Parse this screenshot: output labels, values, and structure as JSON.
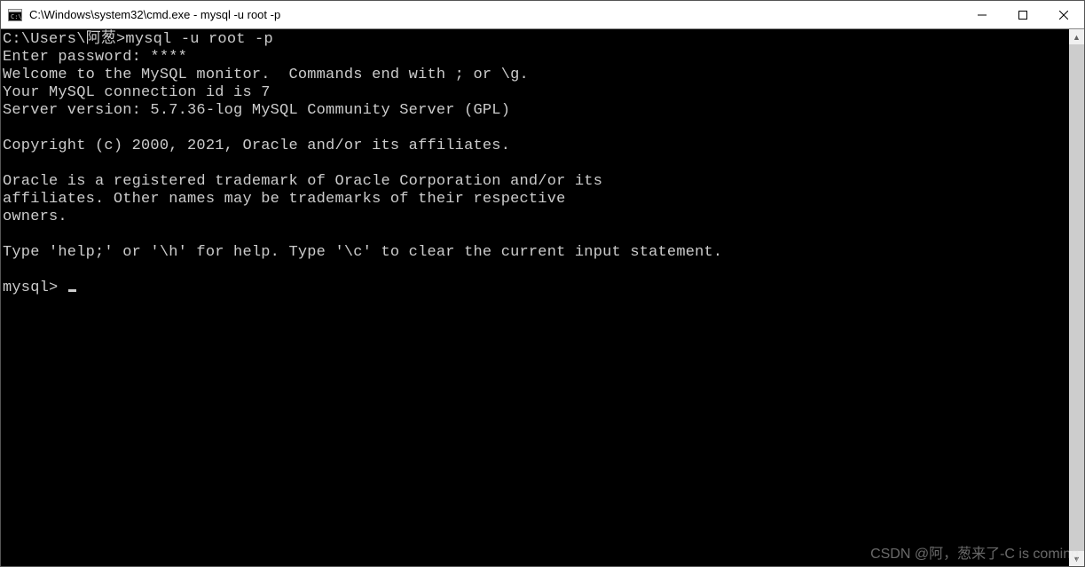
{
  "titlebar": {
    "title": "C:\\Windows\\system32\\cmd.exe - mysql  -u root -p",
    "icon_name": "cmd-icon"
  },
  "terminal": {
    "lines": [
      "C:\\Users\\阿葱>mysql -u root -p",
      "Enter password: ****",
      "Welcome to the MySQL monitor.  Commands end with ; or \\g.",
      "Your MySQL connection id is 7",
      "Server version: 5.7.36-log MySQL Community Server (GPL)",
      "",
      "Copyright (c) 2000, 2021, Oracle and/or its affiliates.",
      "",
      "Oracle is a registered trademark of Oracle Corporation and/or its",
      "affiliates. Other names may be trademarks of their respective",
      "owners.",
      "",
      "Type 'help;' or '\\h' for help. Type '\\c' to clear the current input statement.",
      "",
      "mysql> "
    ]
  },
  "watermark": "CSDN @阿，葱来了-C is coming"
}
